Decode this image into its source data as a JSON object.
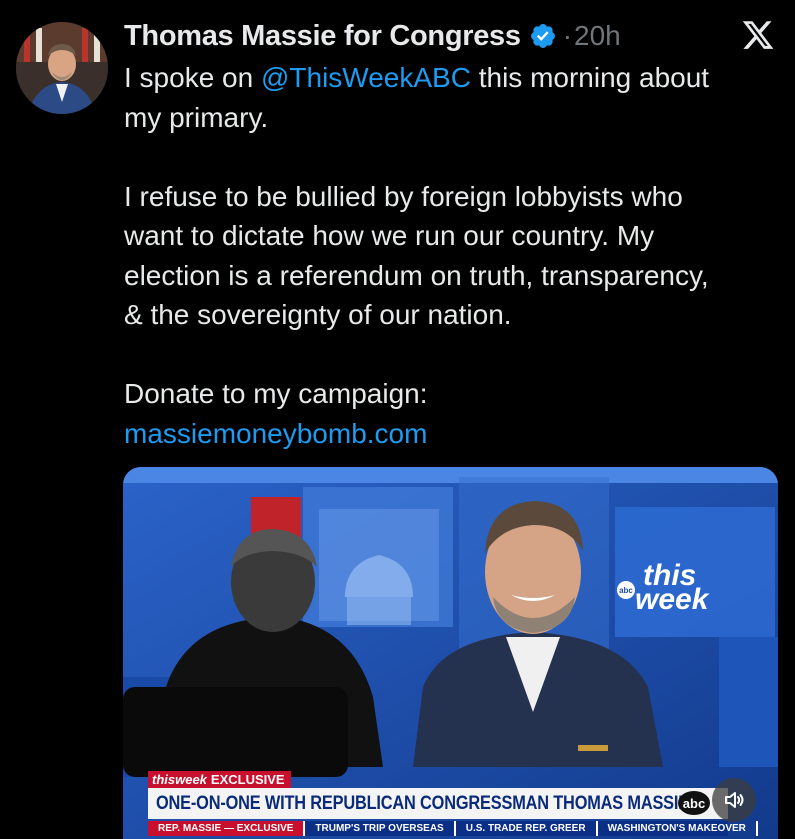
{
  "author": {
    "name": "Thomas Massie for Congress",
    "verified_icon": "verified-badge-icon",
    "separator": "·",
    "time": "20h"
  },
  "platform_icon": "x-logo-icon",
  "tweet": {
    "line1_pre": "I spoke on ",
    "mention": "@ThisWeekABC",
    "line1_post": " this morning about\nmy primary.\n\nI refuse to be bullied by foreign lobbyists who\nwant to dictate how we run our country. My\nelection is a referendum on truth, transparency,\n& the sovereignty of our nation.\n\nDonate to my campaign:\n",
    "link": "massiemoneybomb.com"
  },
  "video": {
    "logo_text_1": "this",
    "logo_text_2": "week",
    "logo_badge": "abc",
    "chyron_brand": "thisweek",
    "chyron_tag": "EXCLUSIVE",
    "headline": "ONE-ON-ONE WITH REPUBLICAN CONGRESSMAN THOMAS MASSIE",
    "network_badge": "abc",
    "ticker": [
      "REP. MASSIE — EXCLUSIVE",
      "TRUMP'S TRIP OVERSEAS",
      "U.S. TRADE REP. GREER",
      "WASHINGTON'S MAKEOVER"
    ],
    "sound_icon": "speaker-icon"
  },
  "colors": {
    "link": "#1d9bf0",
    "muted": "#71767b",
    "text": "#e7e9ea",
    "verified": "#1d9bf0"
  }
}
